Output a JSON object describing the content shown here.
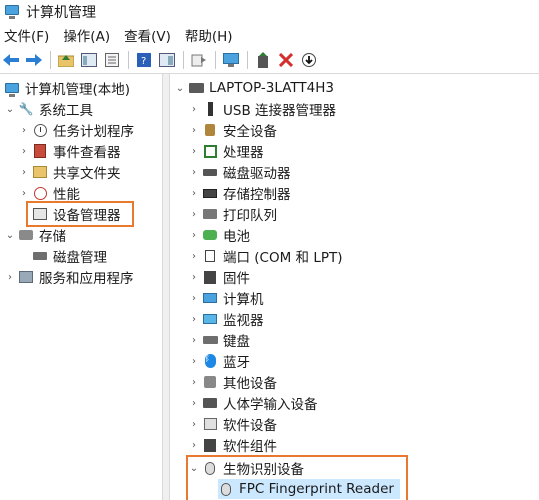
{
  "window": {
    "title": "计算机管理",
    "icon": "computer-management-icon"
  },
  "menu": [
    "文件(F)",
    "操作(A)",
    "查看(V)",
    "帮助(H)"
  ],
  "toolbar": {
    "buttons": [
      "back-arrow-icon",
      "forward-arrow-icon",
      "up-folder-icon",
      "show-hide-tree-icon",
      "properties-icon",
      "help-icon",
      "view-icon",
      "export-icon",
      "computer-icon",
      "add-driver-icon",
      "uninstall-icon",
      "update-icon"
    ]
  },
  "left_tree": {
    "root": "计算机管理(本地)",
    "system_tools": "系统工具",
    "task_scheduler": "任务计划程序",
    "event_viewer": "事件查看器",
    "shared_folders": "共享文件夹",
    "performance": "性能",
    "device_manager": "设备管理器",
    "storage": "存储",
    "disk_management": "磁盘管理",
    "services_apps": "服务和应用程序"
  },
  "right_tree": {
    "root": "LAPTOP-3LATT4H3",
    "categories": [
      "USB 连接器管理器",
      "安全设备",
      "处理器",
      "磁盘驱动器",
      "存储控制器",
      "打印队列",
      "电池",
      "端口 (COM 和 LPT)",
      "固件",
      "计算机",
      "监视器",
      "键盘",
      "蓝牙",
      "其他设备",
      "人体学输入设备",
      "软件设备",
      "软件组件",
      "生物识别设备"
    ],
    "biometric_child": "FPC Fingerprint Reader"
  },
  "colors": {
    "highlight_border": "#e8792f",
    "selection": "#cce8ff"
  }
}
